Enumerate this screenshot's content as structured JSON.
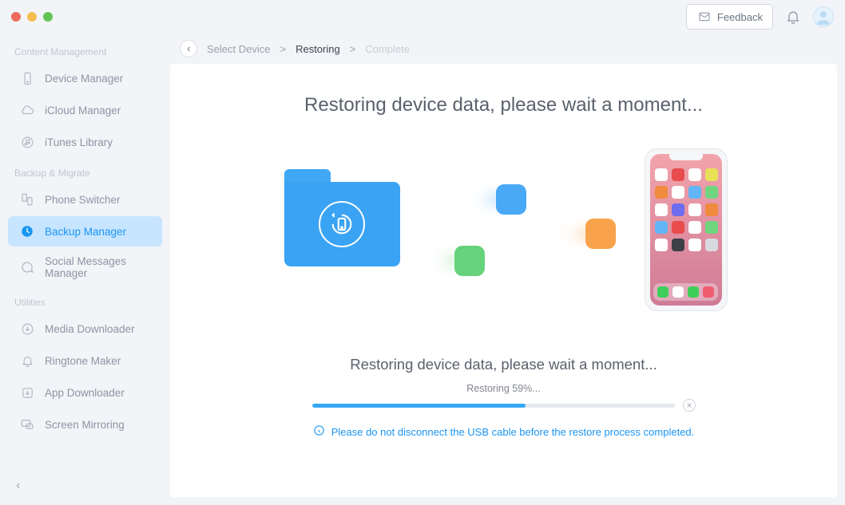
{
  "header": {
    "feedback_label": "Feedback"
  },
  "breadcrumb": {
    "step1": "Select Device",
    "step2": "Restoring",
    "step3": "Complete"
  },
  "sidebar": {
    "sections": [
      {
        "label": "Content Management",
        "items": [
          {
            "label": "Device Manager"
          },
          {
            "label": "iCloud Manager"
          },
          {
            "label": "iTunes Library"
          }
        ]
      },
      {
        "label": "Backup & Migrate",
        "items": [
          {
            "label": "Phone Switcher"
          },
          {
            "label": "Backup Manager"
          },
          {
            "label": "Social Messages Manager"
          }
        ]
      },
      {
        "label": "Utilities",
        "items": [
          {
            "label": "Media Downloader"
          },
          {
            "label": "Ringtone Maker"
          },
          {
            "label": "App Downloader"
          },
          {
            "label": "Screen Mirroring"
          }
        ]
      }
    ]
  },
  "main": {
    "heading": "Restoring device data, please wait a moment...",
    "subheading": "Restoring device data, please wait a moment...",
    "progress_text": "Restoring 59%...",
    "progress_percent": 59,
    "warning": "Please do not disconnect the USB cable before the restore process completed."
  }
}
